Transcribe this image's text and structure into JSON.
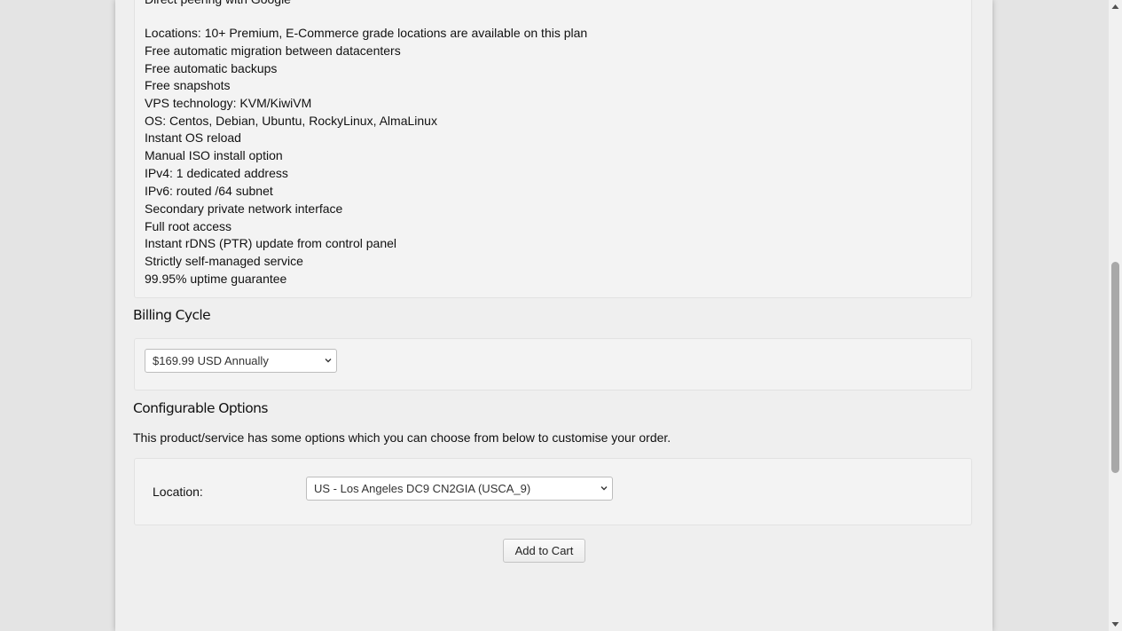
{
  "description": {
    "partial_line": "Direct peering with Google",
    "lines": [
      "Locations: 10+ Premium, E-Commerce grade locations are available on this plan",
      "Free automatic migration between datacenters",
      "Free automatic backups",
      "Free snapshots",
      "VPS technology: KVM/KiwiVM",
      "OS: Centos, Debian, Ubuntu, RockyLinux, AlmaLinux",
      "Instant OS reload",
      "Manual ISO install option",
      "IPv4: 1 dedicated address",
      "IPv6: routed /64 subnet",
      "Secondary private network interface",
      "Full root access",
      "Instant rDNS (PTR) update from control panel",
      "Strictly self-managed service",
      "99.95% uptime guarantee"
    ]
  },
  "billing": {
    "title": "Billing Cycle",
    "selected": "$169.99 USD Annually"
  },
  "configurable": {
    "title": "Configurable Options",
    "intro": "This product/service has some options which you can choose from below to customise your order.",
    "location_label": "Location:",
    "location_selected": "US - Los Angeles DC9 CN2GIA (USCA_9)"
  },
  "actions": {
    "add_to_cart": "Add to Cart"
  },
  "icons": {
    "dropdown": "chevron-down-icon",
    "scroll_up": "arrow-up-icon",
    "scroll_down": "arrow-down-icon"
  }
}
